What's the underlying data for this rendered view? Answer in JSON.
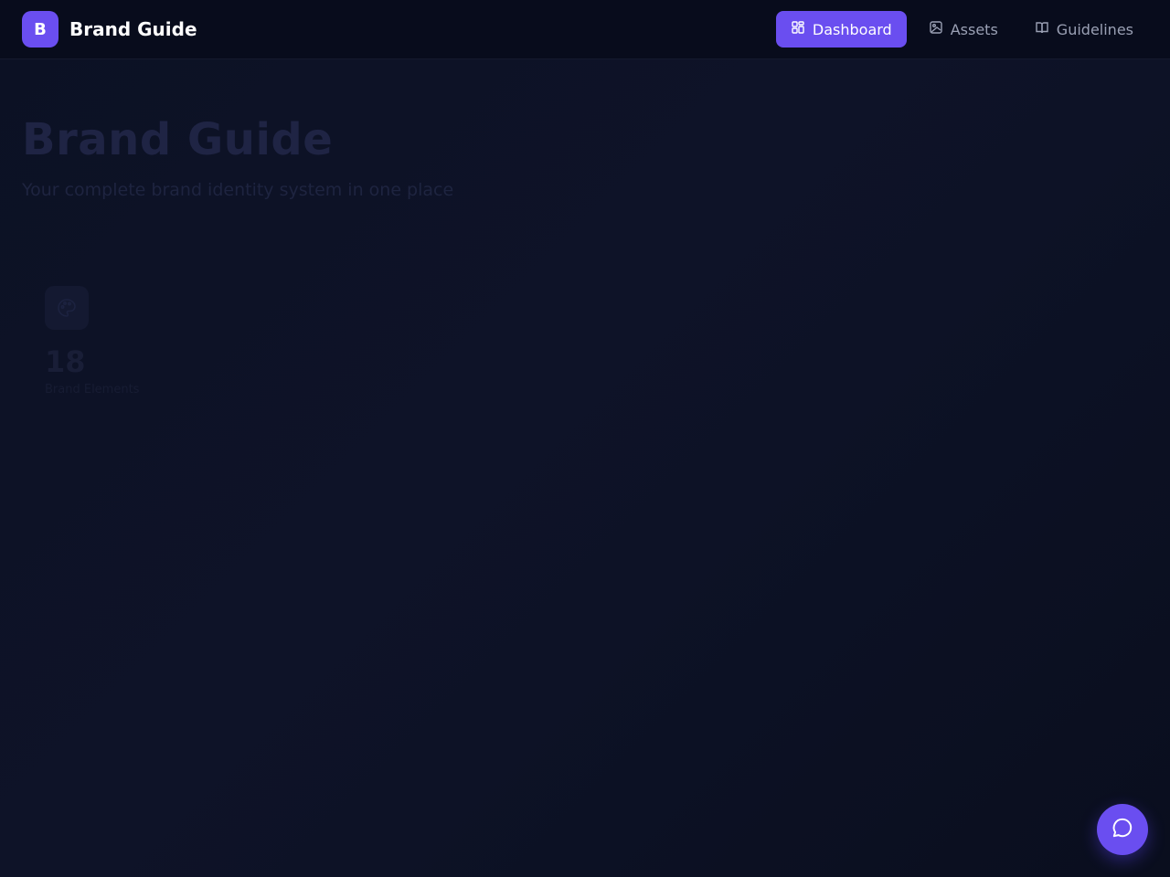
{
  "header": {
    "logo_letter": "B",
    "brand_name": "Brand Guide",
    "nav": [
      {
        "label": "Dashboard",
        "icon": "dashboard-grid-icon",
        "active": true
      },
      {
        "label": "Assets",
        "icon": "image-icon",
        "active": false
      },
      {
        "label": "Guidelines",
        "icon": "book-open-icon",
        "active": false
      }
    ]
  },
  "hero": {
    "title": "Brand Guide",
    "subtitle": "Your complete brand identity system in one place"
  },
  "stats": [
    {
      "icon": "palette-icon",
      "value": "18",
      "label": "Brand Elements"
    }
  ],
  "chat": {
    "icon": "chat-bubble-icon"
  },
  "colors": {
    "accent": "#6a4ef0",
    "background": "#0c1124",
    "topbar": "#080c1c"
  }
}
